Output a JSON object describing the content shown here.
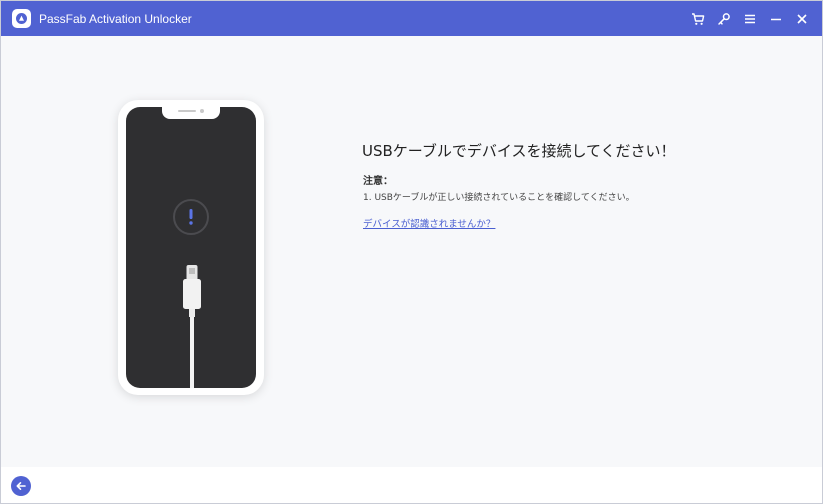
{
  "window": {
    "title": "PassFab Activation Unlocker",
    "accent_color": "#5062d2",
    "controls": [
      {
        "icon": "cart-icon"
      },
      {
        "icon": "key-icon"
      },
      {
        "icon": "menu-icon"
      },
      {
        "icon": "minimize-icon"
      },
      {
        "icon": "close-icon"
      }
    ]
  },
  "main": {
    "title": "USBケーブルでデバイスを接続してください！",
    "note_label": "注意：",
    "note_text": "1. USBケーブルが正しい接続されていることを確認してください。",
    "help_link": "デバイスが認識されませんか？",
    "illustration": {
      "icons": [
        "phone-illustration",
        "exclamation-icon",
        "usb-cable-icon"
      ]
    }
  },
  "footer": {
    "back_icon": "back-arrow-icon"
  }
}
